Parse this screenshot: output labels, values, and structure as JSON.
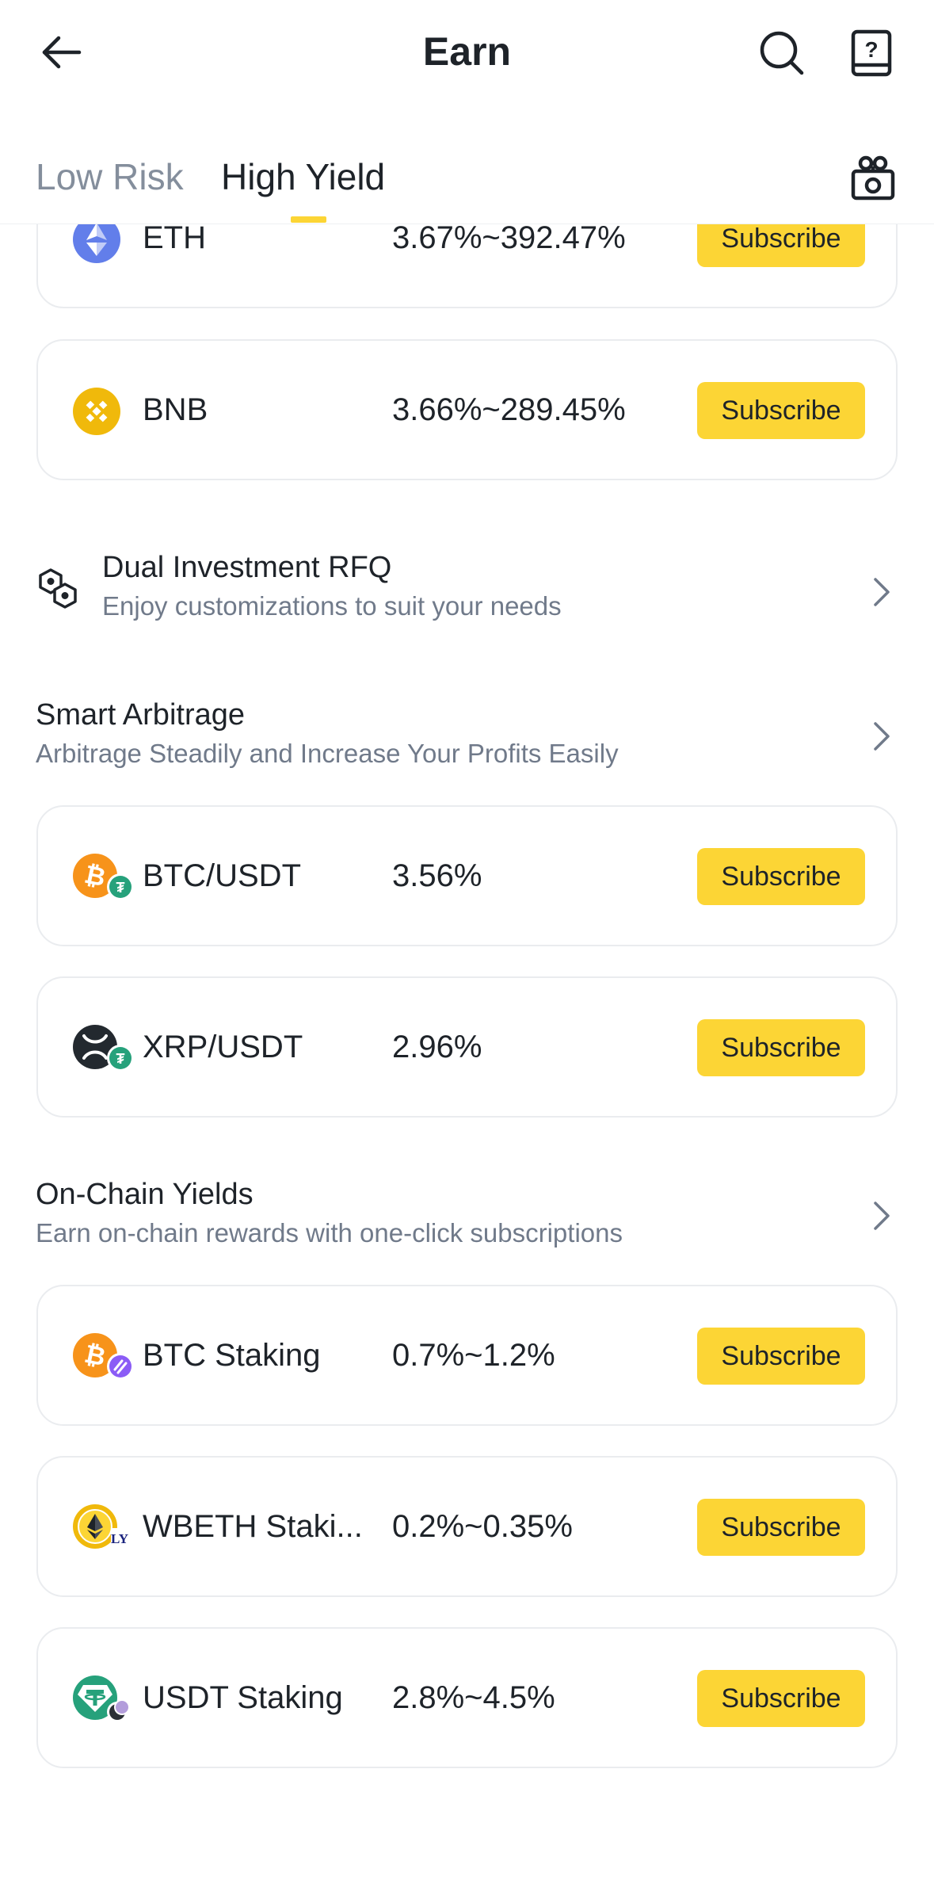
{
  "header": {
    "title": "Earn",
    "tabs": [
      {
        "label": "Low Risk",
        "active": false
      },
      {
        "label": "High Yield",
        "active": true
      }
    ],
    "icons": [
      "back-arrow-icon",
      "search-icon",
      "help-book-icon",
      "gift-icon"
    ]
  },
  "products_top": [
    {
      "name": "ETH",
      "apr": "3.67%~392.47%",
      "button": "Subscribe",
      "icon": "eth-coin-icon"
    },
    {
      "name": "BNB",
      "apr": "3.66%~289.45%",
      "button": "Subscribe",
      "icon": "bnb-coin-icon"
    }
  ],
  "dual_rfq": {
    "title": "Dual Investment RFQ",
    "description": "Enjoy customizations to suit your needs"
  },
  "smart_arbitrage": {
    "title": "Smart Arbitrage",
    "description": "Arbitrage Steadily and Increase Your Profits Easily",
    "items": [
      {
        "name": "BTC/USDT",
        "apr": "3.56%",
        "button": "Subscribe"
      },
      {
        "name": "XRP/USDT",
        "apr": "2.96%",
        "button": "Subscribe"
      }
    ]
  },
  "onchain": {
    "title": "On-Chain Yields",
    "description": "Earn on-chain rewards with one-click subscriptions",
    "items": [
      {
        "name": "BTC Staking",
        "apr": "0.7%~1.2%",
        "button": "Subscribe"
      },
      {
        "name": "WBETH Staki...",
        "apr": "0.2%~0.35%",
        "button": "Subscribe"
      },
      {
        "name": "USDT Staking",
        "apr": "2.8%~4.5%",
        "button": "Subscribe"
      }
    ]
  },
  "colors": {
    "accent": "#fcd535",
    "text_primary": "#1e2329",
    "text_secondary": "#707a8a",
    "tab_inactive": "#848e9c",
    "card_border": "#eaecef",
    "btc": "#f7931a",
    "usdt": "#26a17b",
    "eth": "#627eea",
    "bnb": "#f0b90b"
  }
}
